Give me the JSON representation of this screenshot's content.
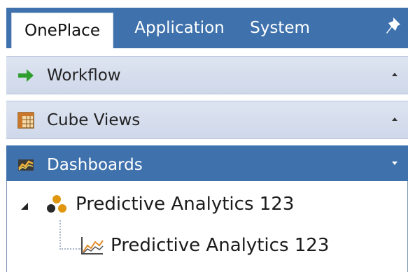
{
  "tabs": [
    {
      "label": "OnePlace",
      "active": true
    },
    {
      "label": "Application",
      "active": false
    },
    {
      "label": "System",
      "active": false
    }
  ],
  "pin_icon": "pin-icon",
  "panels": {
    "workflow": {
      "label": "Workflow",
      "icon": "green-arrow-icon",
      "state": "collapsed"
    },
    "cube_views": {
      "label": "Cube Views",
      "icon": "grid-icon",
      "state": "collapsed"
    },
    "dashboards": {
      "label": "Dashboards",
      "icon": "chart-icon",
      "state": "expanded"
    }
  },
  "tree": {
    "group": {
      "label": "Predictive Analytics 123",
      "icon": "group-dots-icon",
      "expanded": true
    },
    "child": {
      "label": "Predictive Analytics 123",
      "icon": "line-chart-icon"
    }
  },
  "colors": {
    "header_blue": "#3f72ad",
    "panel_bg": "#dde4f1",
    "arrow_green": "#2e9e2e"
  }
}
